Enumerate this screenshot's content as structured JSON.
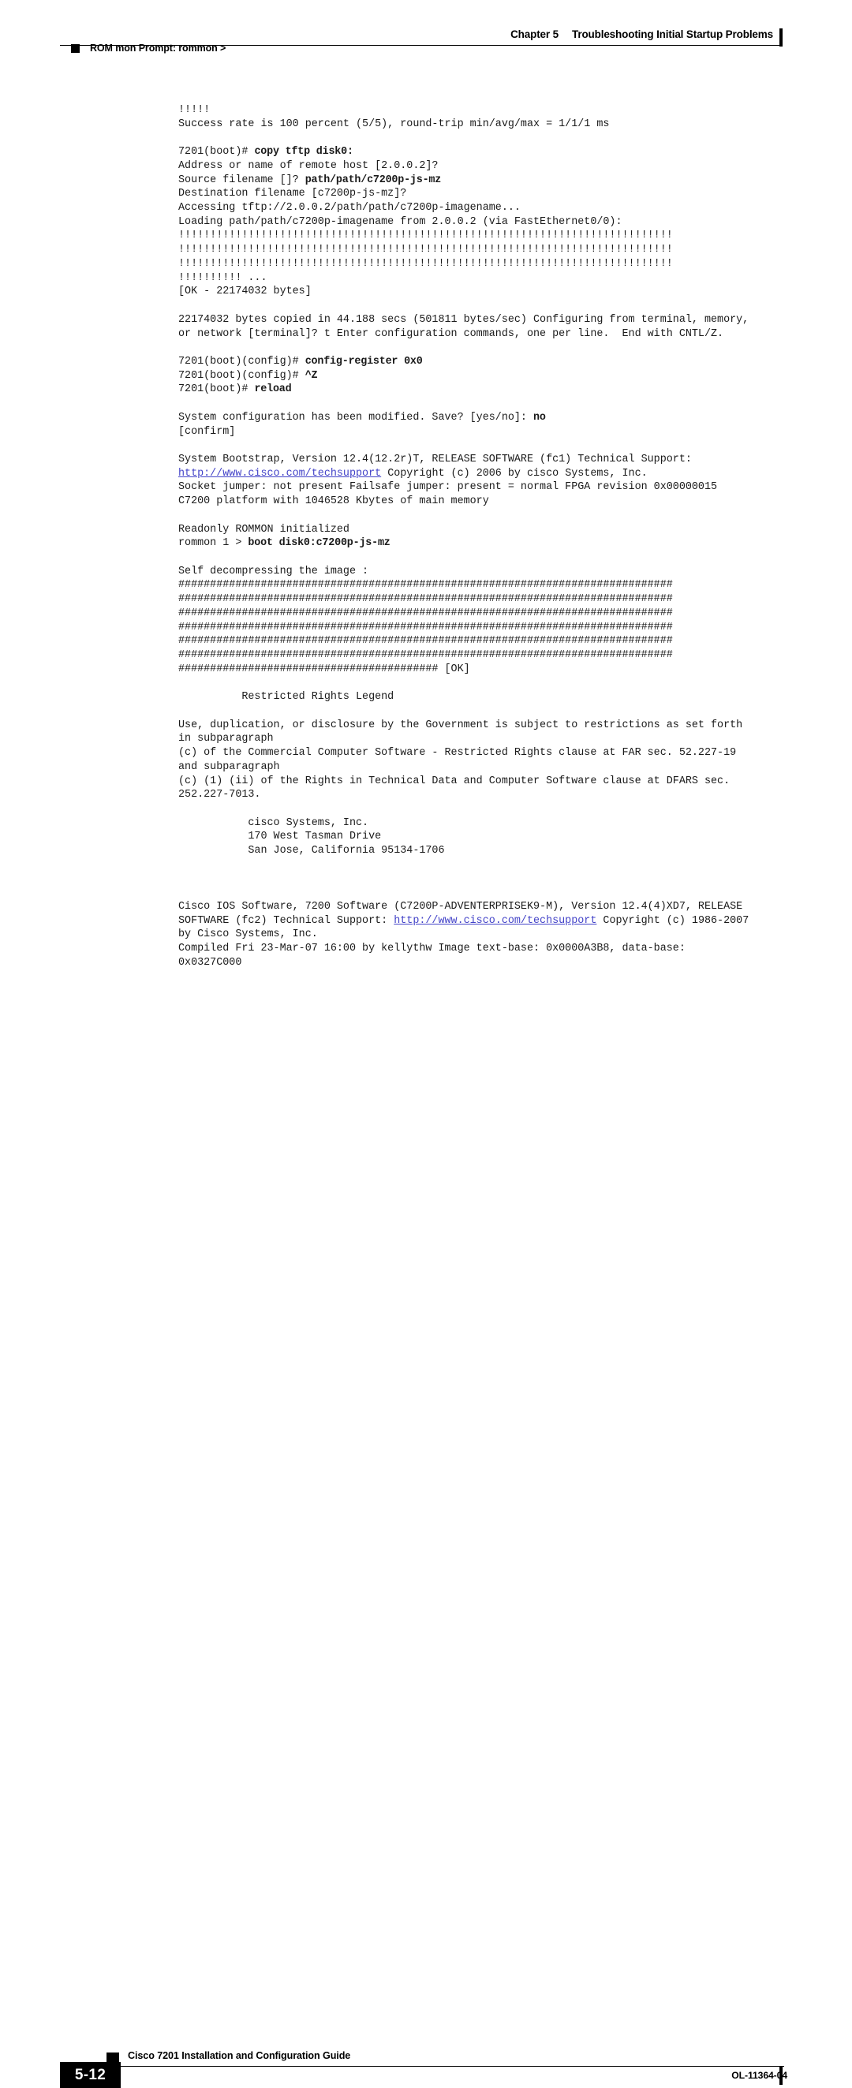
{
  "header": {
    "chapter_label": "Chapter 5",
    "chapter_title": "Troubleshooting Initial Startup Problems",
    "runhead": "ROM mon Prompt: rommon >"
  },
  "footer": {
    "page_number": "5-12",
    "guide_title": "Cisco 7201 Installation and Configuration Guide",
    "doc_id": "OL-11364-04"
  },
  "colors": {
    "link": "#4343c8",
    "text": "#1a1a1a",
    "rule": "#000000"
  },
  "console": {
    "lines": [
      {
        "id": "l01",
        "segs": [
          {
            "t": "!!!!!"
          }
        ]
      },
      {
        "id": "l02",
        "segs": [
          {
            "t": "Success rate is 100 percent (5/5), round-trip min/avg/max = 1/1/1 ms"
          }
        ]
      },
      {
        "id": "l03",
        "blank": true,
        "segs": []
      },
      {
        "id": "l04",
        "segs": [
          {
            "t": "7201(boot)# "
          },
          {
            "t": "copy tftp disk0:",
            "b": true
          }
        ]
      },
      {
        "id": "l05",
        "segs": [
          {
            "t": "Address or name of remote host [2.0.0.2]?"
          }
        ]
      },
      {
        "id": "l06",
        "segs": [
          {
            "t": "Source filename []? "
          },
          {
            "t": "path/path/c7200p-js-mz",
            "b": true
          }
        ]
      },
      {
        "id": "l07",
        "segs": [
          {
            "t": "Destination filename [c7200p-js-mz]?"
          }
        ]
      },
      {
        "id": "l08",
        "segs": [
          {
            "t": "Accessing tftp://2.0.0.2/path/path/c7200p-imagename..."
          }
        ]
      },
      {
        "id": "l09",
        "segs": [
          {
            "t": "Loading path/path/c7200p-imagename from 2.0.0.2 (via FastEthernet0/0):"
          }
        ]
      },
      {
        "id": "l10",
        "segs": [
          {
            "t": "!!!!!!!!!!!!!!!!!!!!!!!!!!!!!!!!!!!!!!!!!!!!!!!!!!!!!!!!!!!!!!!!!!!!!!!!!!!!!!"
          }
        ]
      },
      {
        "id": "l11",
        "segs": [
          {
            "t": "!!!!!!!!!!!!!!!!!!!!!!!!!!!!!!!!!!!!!!!!!!!!!!!!!!!!!!!!!!!!!!!!!!!!!!!!!!!!!!"
          }
        ]
      },
      {
        "id": "l12",
        "segs": [
          {
            "t": "!!!!!!!!!!!!!!!!!!!!!!!!!!!!!!!!!!!!!!!!!!!!!!!!!!!!!!!!!!!!!!!!!!!!!!!!!!!!!!"
          }
        ]
      },
      {
        "id": "l13",
        "segs": [
          {
            "t": "!!!!!!!!!! ..."
          }
        ]
      },
      {
        "id": "l14",
        "segs": [
          {
            "t": "[OK - 22174032 bytes]"
          }
        ]
      },
      {
        "id": "l15",
        "blank": true,
        "segs": []
      },
      {
        "id": "l16",
        "segs": [
          {
            "t": "22174032 bytes copied in 44.188 secs (501811 bytes/sec) Configuring from terminal, memory,"
          }
        ]
      },
      {
        "id": "l17",
        "segs": [
          {
            "t": "or network [terminal]? t Enter configuration commands, one per line.  End with CNTL/Z."
          }
        ]
      },
      {
        "id": "l18",
        "blank": true,
        "segs": []
      },
      {
        "id": "l19",
        "segs": [
          {
            "t": "7201(boot)(config)# "
          },
          {
            "t": "config-register 0x0",
            "b": true
          }
        ]
      },
      {
        "id": "l20",
        "segs": [
          {
            "t": "7201(boot)(config)# "
          },
          {
            "t": "^Z",
            "b": true
          }
        ]
      },
      {
        "id": "l21",
        "segs": [
          {
            "t": "7201(boot)# "
          },
          {
            "t": "reload",
            "b": true
          }
        ]
      },
      {
        "id": "l22",
        "blank": true,
        "segs": []
      },
      {
        "id": "l23",
        "segs": [
          {
            "t": "System configuration has been modified. Save? [yes/no]: "
          },
          {
            "t": "no",
            "b": true
          }
        ]
      },
      {
        "id": "l24",
        "segs": [
          {
            "t": "[confirm]"
          }
        ]
      },
      {
        "id": "l25",
        "blank": true,
        "segs": []
      },
      {
        "id": "l26",
        "segs": [
          {
            "t": "System Bootstrap, Version 12.4(12.2r)T, RELEASE SOFTWARE (fc1) Technical Support:"
          }
        ]
      },
      {
        "id": "l27",
        "segs": [
          {
            "t": "http://www.cisco.com/techsupport",
            "link": true
          },
          {
            "t": " Copyright (c) 2006 by cisco Systems, Inc."
          }
        ]
      },
      {
        "id": "l28",
        "segs": [
          {
            "t": "Socket jumper: not present Failsafe jumper: present = normal FPGA revision 0x00000015"
          }
        ]
      },
      {
        "id": "l29",
        "segs": [
          {
            "t": "C7200 platform with 1046528 Kbytes of main memory"
          }
        ]
      },
      {
        "id": "l30",
        "blank": true,
        "segs": []
      },
      {
        "id": "l31",
        "segs": [
          {
            "t": "Readonly ROMMON initialized"
          }
        ]
      },
      {
        "id": "l32",
        "segs": [
          {
            "t": "rommon 1 > "
          },
          {
            "t": "boot disk0:c7200p-js-mz",
            "b": true
          }
        ]
      },
      {
        "id": "l33",
        "blank": true,
        "segs": []
      },
      {
        "id": "l34",
        "segs": [
          {
            "t": "Self decompressing the image :"
          }
        ]
      },
      {
        "id": "l35",
        "segs": [
          {
            "t": "##############################################################################"
          }
        ]
      },
      {
        "id": "l36",
        "segs": [
          {
            "t": "##############################################################################"
          }
        ]
      },
      {
        "id": "l37",
        "segs": [
          {
            "t": "##############################################################################"
          }
        ]
      },
      {
        "id": "l38",
        "segs": [
          {
            "t": "##############################################################################"
          }
        ]
      },
      {
        "id": "l39",
        "segs": [
          {
            "t": "##############################################################################"
          }
        ]
      },
      {
        "id": "l40",
        "segs": [
          {
            "t": "##############################################################################"
          }
        ]
      },
      {
        "id": "l41",
        "segs": [
          {
            "t": "######################################### [OK]"
          }
        ]
      },
      {
        "id": "l42",
        "blank": true,
        "segs": []
      },
      {
        "id": "l43",
        "segs": [
          {
            "t": "          Restricted Rights Legend"
          }
        ]
      },
      {
        "id": "l44",
        "blank": true,
        "segs": []
      },
      {
        "id": "l45",
        "segs": [
          {
            "t": "Use, duplication, or disclosure by the Government is subject to restrictions as set forth"
          }
        ]
      },
      {
        "id": "l46",
        "segs": [
          {
            "t": "in subparagraph"
          }
        ]
      },
      {
        "id": "l47",
        "segs": [
          {
            "t": "(c) of the Commercial Computer Software - Restricted Rights clause at FAR sec. 52.227-19"
          }
        ]
      },
      {
        "id": "l48",
        "segs": [
          {
            "t": "and subparagraph"
          }
        ]
      },
      {
        "id": "l49",
        "segs": [
          {
            "t": "(c) (1) (ii) of the Rights in Technical Data and Computer Software clause at DFARS sec."
          }
        ]
      },
      {
        "id": "l50",
        "segs": [
          {
            "t": "252.227-7013."
          }
        ]
      },
      {
        "id": "l51",
        "blank": true,
        "segs": []
      },
      {
        "id": "l52",
        "segs": [
          {
            "t": "           cisco Systems, Inc."
          }
        ]
      },
      {
        "id": "l53",
        "segs": [
          {
            "t": "           170 West Tasman Drive"
          }
        ]
      },
      {
        "id": "l54",
        "segs": [
          {
            "t": "           San Jose, California 95134-1706"
          }
        ]
      },
      {
        "id": "l55",
        "blank": true,
        "segs": []
      },
      {
        "id": "l56",
        "blank": true,
        "segs": []
      },
      {
        "id": "l57",
        "blank": true,
        "segs": []
      },
      {
        "id": "l58",
        "segs": [
          {
            "t": "Cisco IOS Software, 7200 Software (C7200P-ADVENTERPRISEK9-M), Version 12.4(4)XD7, RELEASE"
          }
        ]
      },
      {
        "id": "l59",
        "segs": [
          {
            "t": "SOFTWARE (fc2) Technical Support: "
          },
          {
            "t": "http://www.cisco.com/techsupport",
            "link": true
          },
          {
            "t": " Copyright (c) 1986-2007"
          }
        ]
      },
      {
        "id": "l60",
        "segs": [
          {
            "t": "by Cisco Systems, Inc."
          }
        ]
      },
      {
        "id": "l61",
        "segs": [
          {
            "t": "Compiled Fri 23-Mar-07 16:00 by kellythw Image text-base: 0x0000A3B8, data-base:"
          }
        ]
      },
      {
        "id": "l62",
        "segs": [
          {
            "t": "0x0327C000"
          }
        ]
      }
    ]
  }
}
